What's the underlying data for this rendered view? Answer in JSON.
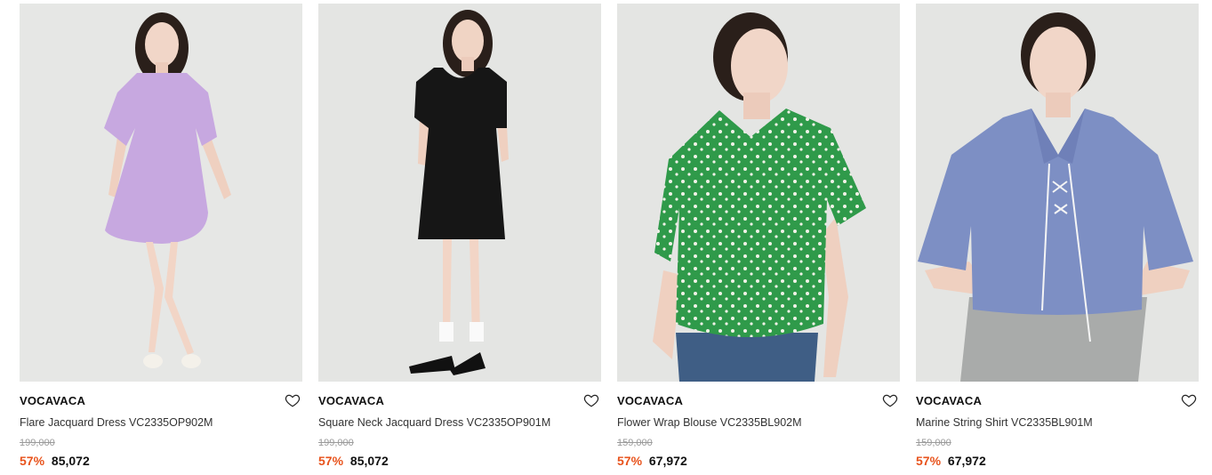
{
  "colors": {
    "discount": "#e8531c",
    "photo_bg": "#e4e5e3"
  },
  "products": [
    {
      "brand": "VOCAVACA",
      "name": "Flare Jacquard Dress VC2335OP902M",
      "original_price": "199,000",
      "discount": "57%",
      "price": "85,072",
      "garment_color": "#c7a8e0",
      "icon": "heart-outline-icon"
    },
    {
      "brand": "VOCAVACA",
      "name": "Square Neck Jacquard Dress VC2335OP901M",
      "original_price": "199,000",
      "discount": "57%",
      "price": "85,072",
      "garment_color": "#161616",
      "icon": "heart-outline-icon"
    },
    {
      "brand": "VOCAVACA",
      "name": "Flower Wrap Blouse VC2335BL902M",
      "original_price": "159,000",
      "discount": "57%",
      "price": "67,972",
      "garment_color": "#2f9a4a",
      "icon": "heart-outline-icon"
    },
    {
      "brand": "VOCAVACA",
      "name": "Marine String Shirt VC2335BL901M",
      "original_price": "159,000",
      "discount": "57%",
      "price": "67,972",
      "garment_color": "#7d8fc4",
      "icon": "heart-outline-icon"
    }
  ]
}
